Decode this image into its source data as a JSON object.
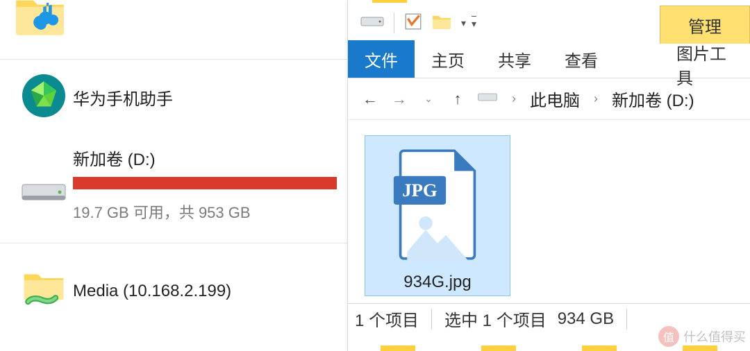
{
  "sidebar": {
    "hisuite_label": "华为手机助手",
    "drive_label": "新加卷 (D:)",
    "drive_sub": "19.7 GB 可用，共 953 GB",
    "media_label": "Media (10.168.2.199)"
  },
  "explorer": {
    "manage_tab": "管理",
    "tabs": {
      "file": "文件",
      "home": "主页",
      "share": "共享",
      "view": "查看",
      "tools": "图片工具"
    },
    "breadcrumb": {
      "pc": "此电脑",
      "drive": "新加卷 (D:)"
    },
    "file": {
      "name": "934G.jpg",
      "badge": "JPG"
    },
    "status": {
      "count": "1 个项目",
      "selected": "选中 1 个项目",
      "size": "934 GB"
    }
  },
  "watermark": {
    "badge": "值",
    "text": "什么值得买"
  }
}
